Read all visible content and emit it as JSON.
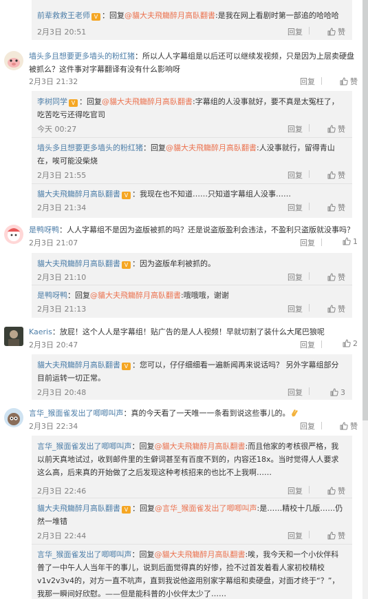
{
  "actions": {
    "reply": "回复",
    "like": "赞"
  },
  "comments": [
    {
      "id": "c0",
      "replies": [
        {
          "author": "前辈救救王老师",
          "prefix": "：回复",
          "target": "@貓大夫飛觴醉月高臥翻書",
          "text": ":是我在网上看剧时第一部追的哈哈哈",
          "time": "2月3日 20:51",
          "likes": ""
        }
      ]
    },
    {
      "id": "c1",
      "author": "墙头多且想要更多墙头的粉红猪",
      "text": "：所以人人字幕组是以后还可以继续发视频，只是因为上层卖硬盘被抓么？这件事对字幕翻译有没有什么影响呀",
      "time": "2月3日 21:32",
      "likes": "",
      "replies": [
        {
          "author": "李树同学",
          "prefix": "：回复",
          "target": "@貓大夫飛觴醉月高臥翻書",
          "text": ":字幕组的人没事就好，要不真是太冤枉了，吃苦吃亏还得吃官司",
          "time": "今天 00:27",
          "likes": ""
        },
        {
          "author": "墙头多且想要更多墙头的粉红猪",
          "prefix": "：回复",
          "target": "@貓大夫飛觴醉月高臥翻書",
          "text": ":人没事就行，留得青山在，唉可能没柴烧",
          "time": "2月3日 21:55",
          "likes": ""
        },
        {
          "author": "貓大夫飛觴醉月高臥翻書",
          "prefix": "",
          "target": "",
          "text": "：我现在也不知道……只知道字幕组人没事……",
          "time": "2月3日 21:34",
          "likes": ""
        }
      ]
    },
    {
      "id": "c2",
      "author": "是鸭呀鸭",
      "text": "：人人字幕组不是因为盗版被抓的吗？还是说盗版盈利会违法，不盈利只盗版就没事吗？",
      "time": "2月3日 21:07",
      "likes": "1",
      "replies": [
        {
          "author": "貓大夫飛觴醉月高臥翻書",
          "prefix": "",
          "target": "",
          "text": "：因为盗版牟利被抓的。",
          "time": "2月3日 21:10",
          "likes": ""
        },
        {
          "author": "是鸭呀鸭",
          "prefix": "：回复",
          "target": "@貓大夫飛觴醉月高臥翻書",
          "text": ":哦哦哦，谢谢",
          "time": "2月3日 21:13",
          "likes": ""
        }
      ]
    },
    {
      "id": "c3",
      "author": "Kaeris",
      "text": "：放屁！这个人人是字幕组！贴广告的是人人视频！早就切割了装什么大尾巴狼呢",
      "time": "2月3日 20:47",
      "likes": "2",
      "replies": [
        {
          "author": "貓大夫飛觴醉月高臥翻書",
          "prefix": "",
          "target": "",
          "text": "：您可以，仔仔细细看一遍新闻再来说话吗？ 另外字幕组部分目前运转一切正常。",
          "time": "2月3日 20:48",
          "likes": "3"
        }
      ]
    },
    {
      "id": "c4",
      "author": "言华_猴面雀发出了唧唧叫声",
      "text": "：真的今天看了一天唯一一条看到说这些事儿的。",
      "time": "2月3日 22:34",
      "likes": "",
      "replies": [
        {
          "author": "言华_猴面雀发出了唧唧叫声",
          "prefix": "：回复",
          "target": "@貓大夫飛觴醉月高臥翻書",
          "text": ":而且他家的考核很严格，我以前天真地试过，收到邮件里的生僻词甚至有百度不到的，内容还18x。当时觉得人人要求这么高，后来真的开始做了之后发现这种考核招来的也比不上我啊……",
          "time": "2月3日 22:46",
          "likes": ""
        },
        {
          "author": "貓大夫飛觴醉月高臥翻書",
          "prefix": "：回复",
          "target": "@言华_猴面雀发出了唧唧叫声",
          "text": ":是……精校十几版……仍然一堆错",
          "time": "2月3日 22:44",
          "likes": ""
        },
        {
          "author": "言华_猴面雀发出了唧唧叫声",
          "prefix": "：回复",
          "target": "@貓大夫飛觴醉月高臥翻書",
          "text": ":唉，我今天和一个小伙伴科普了一中午人人当年干的事儿，说到后面觉得真的好惨，捡不过首发着看人家初校精校v1v2v3v4的，对方一直不吭声，直到我说他盗用别家字幕组和卖硬盘，对面才终于“？”，我那一瞬间好欣慰。——但是能科普的小伙伴太少了……",
          "time": "",
          "likes": ""
        }
      ]
    }
  ]
}
